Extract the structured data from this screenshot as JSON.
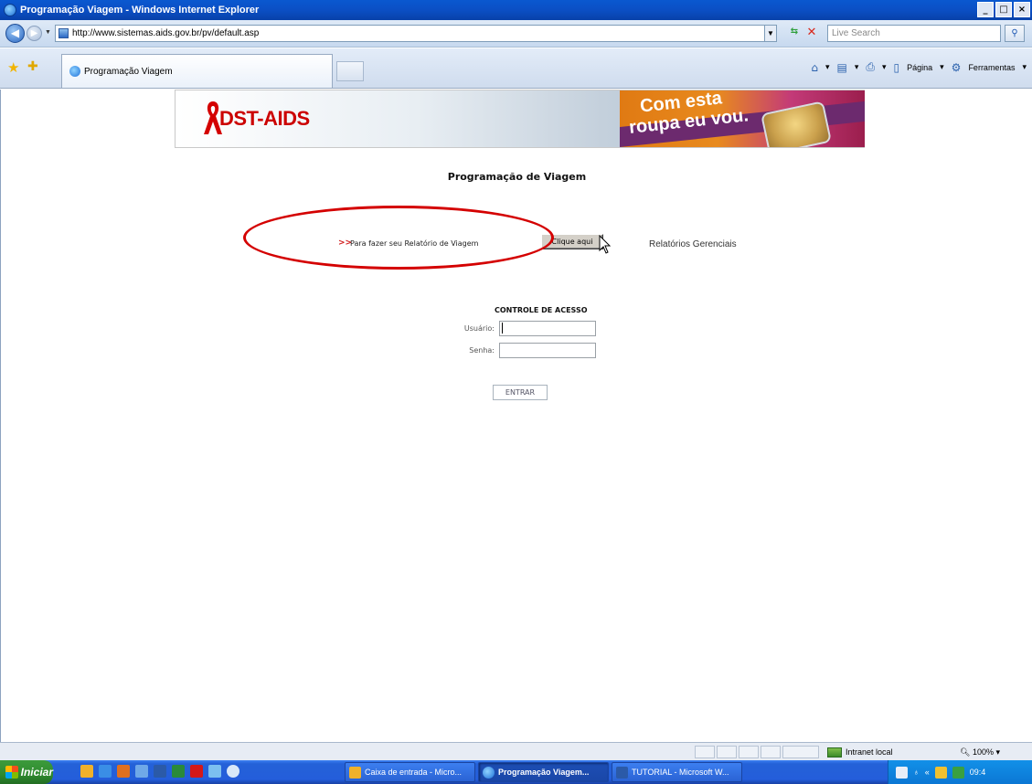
{
  "window": {
    "title": "Programação Viagem - Windows Internet Explorer",
    "controls": [
      "_",
      "□",
      "×"
    ]
  },
  "address": {
    "url": "http://www.sistemas.aids.gov.br/pv/default.asp",
    "search_placeholder": "Live Search"
  },
  "tab": {
    "label": "Programação Viagem"
  },
  "commands": {
    "page": "Página",
    "tools": "Ferramentas"
  },
  "banner": {
    "logo_text": "DST-AIDS",
    "promo_line1": "Com esta",
    "promo_line2": "roupa eu vou."
  },
  "page": {
    "title": "Programação de Viagem",
    "report_arrows": ">>",
    "report_text": "Para fazer seu Relatório de Viagem",
    "report_button": "Clique aqui",
    "management_link": "Relatórios Gerenciais"
  },
  "login": {
    "title": "CONTROLE DE ACESSO",
    "user_label": "Usuário:",
    "user_value": "",
    "password_label": "Senha:",
    "password_value": "",
    "submit": "ENTRAR"
  },
  "status": {
    "zone": "Intranet local",
    "zoom": "100%"
  },
  "taskbar": {
    "start": "Iniciar",
    "tasks": [
      {
        "label": "Caixa de entrada - Micro...",
        "active": false
      },
      {
        "label": "Programação Viagem...",
        "active": true
      },
      {
        "label": "TUTORIAL - Microsoft W...",
        "active": false
      }
    ],
    "clock": "09:4"
  },
  "colors": {
    "accent_red": "#d40000",
    "titlebar_blue": "#0b4fc4",
    "start_green": "#2f8a2f"
  }
}
